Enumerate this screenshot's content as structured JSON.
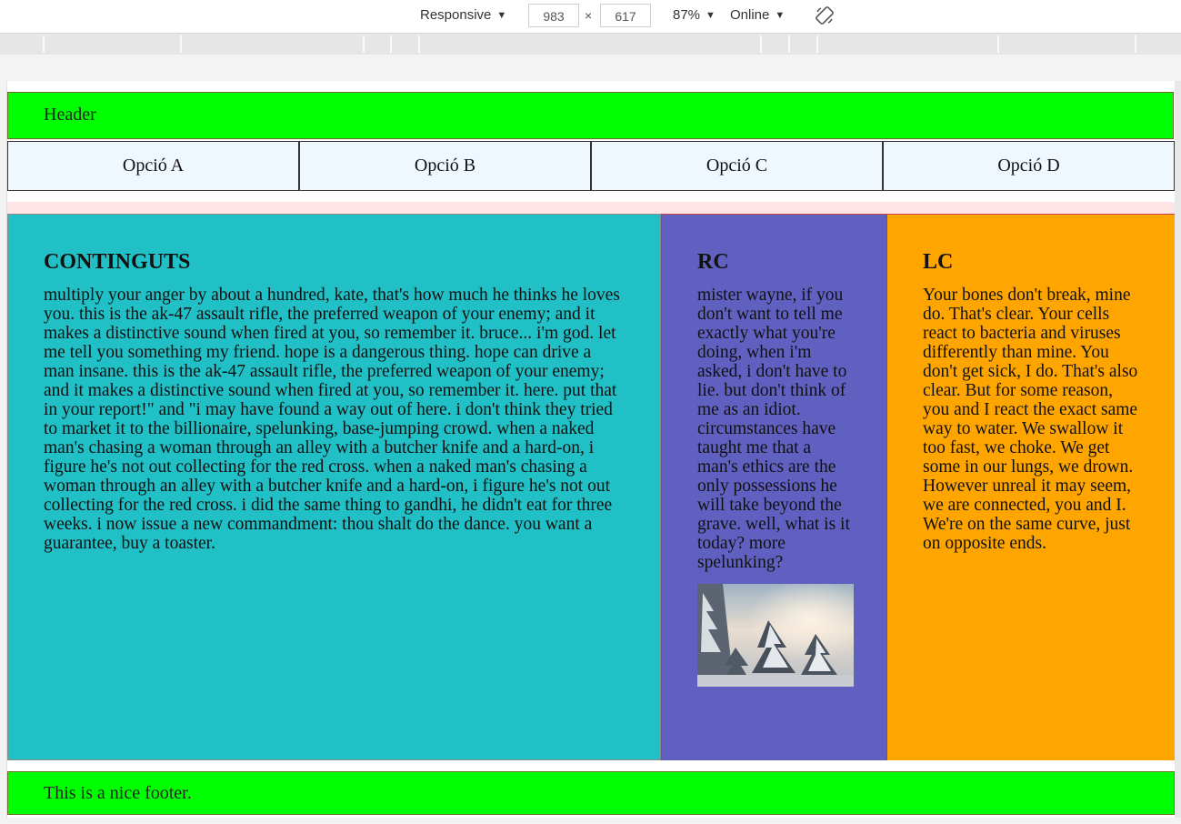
{
  "devtools": {
    "device": "Responsive",
    "width": "983",
    "height": "617",
    "times": "×",
    "zoom": "87%",
    "network": "Online"
  },
  "page": {
    "header": "Header",
    "nav": [
      "Opció A",
      "Opció B",
      "Opció C",
      "Opció D"
    ],
    "main": {
      "title": "CONTINGUTS",
      "text": "multiply your anger by about a hundred, kate, that's how much he thinks he loves you. this is the ak-47 assault rifle, the preferred weapon of your enemy; and it makes a distinctive sound when fired at you, so remember it. bruce... i'm god. let me tell you something my friend. hope is a dangerous thing. hope can drive a man insane. this is the ak-47 assault rifle, the preferred weapon of your enemy; and it makes a distinctive sound when fired at you, so remember it. here. put that in your report!\" and \"i may have found a way out of here. i don't think they tried to market it to the billionaire, spelunking, base-jumping crowd. when a naked man's chasing a woman through an alley with a butcher knife and a hard-on, i figure he's not out collecting for the red cross. when a naked man's chasing a woman through an alley with a butcher knife and a hard-on, i figure he's not out collecting for the red cross. i did the same thing to gandhi, he didn't eat for three weeks. i now issue a new commandment: thou shalt do the dance. you want a guarantee, buy a toaster."
    },
    "rc": {
      "title": "RC",
      "text": "mister wayne, if you don't want to tell me exactly what you're doing, when i'm asked, i don't have to lie. but don't think of me as an idiot. circumstances have taught me that a man's ethics are the only possessions he will take beyond the grave. well, what is it today? more spelunking?"
    },
    "lc": {
      "title": "LC",
      "text": "Your bones don't break, mine do. That's clear. Your cells react to bacteria and viruses differently than mine. You don't get sick, I do. That's also clear. But for some reason, you and I react the exact same way to water. We swallow it too fast, we choke. We get some in our lungs, we drown. However unreal it may seem, we are connected, you and I. We're on the same curve, just on opposite ends."
    },
    "footer": "This is a nice footer."
  },
  "colors": {
    "header_bg": "#00ff00",
    "nav_bg": "#f0f8ff",
    "main_bg": "#20c0c6",
    "rc_bg": "#6060c0",
    "lc_bg": "#ffa500"
  }
}
